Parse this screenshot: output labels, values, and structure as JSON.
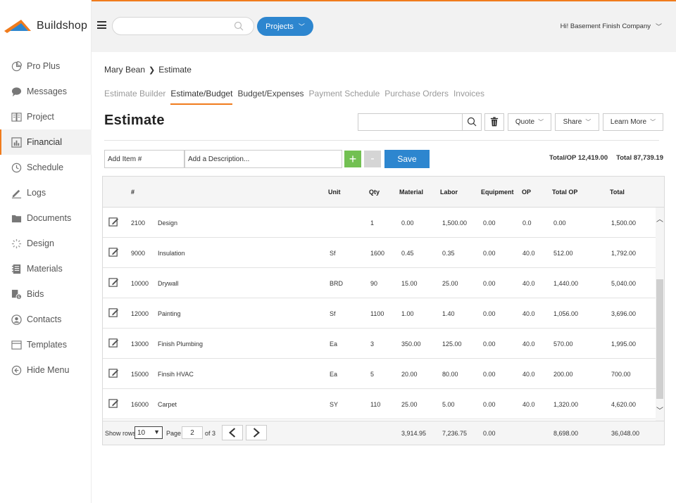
{
  "brand": {
    "name": "Buildshop"
  },
  "sidebar": {
    "items": [
      {
        "label": "Pro Plus",
        "icon": "pie-chart-icon"
      },
      {
        "label": "Messages",
        "icon": "chat-bubble-icon"
      },
      {
        "label": "Project",
        "icon": "book-icon"
      },
      {
        "label": "Financial",
        "icon": "bar-chart-icon",
        "active": true
      },
      {
        "label": "Schedule",
        "icon": "clock-icon"
      },
      {
        "label": "Logs",
        "icon": "pencil-icon"
      },
      {
        "label": "Documents",
        "icon": "folder-icon"
      },
      {
        "label": "Design",
        "icon": "spinner-icon"
      },
      {
        "label": "Materials",
        "icon": "binder-icon"
      },
      {
        "label": "Bids",
        "icon": "bids-icon"
      },
      {
        "label": "Contacts",
        "icon": "contact-icon"
      },
      {
        "label": "Templates",
        "icon": "template-icon"
      },
      {
        "label": "Hide Menu",
        "icon": "arrow-left-circle-icon"
      }
    ]
  },
  "header": {
    "search_placeholder": "",
    "projects_label": "Projects",
    "greeting": "Hi! Basement Finish Company"
  },
  "breadcrumb": {
    "client": "Mary Bean",
    "current": "Estimate"
  },
  "tabs": [
    {
      "label": "Estimate Builder",
      "state": "inactive"
    },
    {
      "label": "Estimate/Budget",
      "state": "active"
    },
    {
      "label": "Budget/Expenses",
      "state": "dark"
    },
    {
      "label": "Payment Schedule",
      "state": "inactive"
    },
    {
      "label": "Purchase Orders",
      "state": "inactive"
    },
    {
      "label": "Invoices",
      "state": "inactive"
    }
  ],
  "page_title": "Estimate",
  "toolbar": {
    "quote_label": "Quote",
    "share_label": "Share",
    "learn_more_label": "Learn More"
  },
  "entry": {
    "item_placeholder": "Add Item #",
    "description_placeholder": "Add a Description...",
    "add_label": "+",
    "remove_label": "-",
    "save_label": "Save"
  },
  "totals": {
    "total_op": "Total/OP 12,419.00",
    "total": "Total 87,739.19"
  },
  "table": {
    "columns": [
      "#",
      "Unit",
      "Qty",
      "Material",
      "Labor",
      "Equipment",
      "OP",
      "Total OP",
      "Total"
    ],
    "rows": [
      {
        "num": "2100",
        "desc": "Design",
        "unit": "",
        "qty": "1",
        "material": "0.00",
        "labor": "1,500.00",
        "equipment": "0.00",
        "op": "0.0",
        "total_op": "0.00",
        "total": "1,500.00"
      },
      {
        "num": "9000",
        "desc": "Insulation",
        "unit": "Sf",
        "qty": "1600",
        "material": "0.45",
        "labor": "0.35",
        "equipment": "0.00",
        "op": "40.0",
        "total_op": "512.00",
        "total": "1,792.00"
      },
      {
        "num": "10000",
        "desc": "Drywall",
        "unit": "BRD",
        "qty": "90",
        "material": "15.00",
        "labor": "25.00",
        "equipment": "0.00",
        "op": "40.0",
        "total_op": "1,440.00",
        "total": "5,040.00"
      },
      {
        "num": "12000",
        "desc": "Painting",
        "unit": "Sf",
        "qty": "1100",
        "material": "1.00",
        "labor": "1.40",
        "equipment": "0.00",
        "op": "40.0",
        "total_op": "1,056.00",
        "total": "3,696.00"
      },
      {
        "num": "13000",
        "desc": "Finish Plumbing",
        "unit": "Ea",
        "qty": "3",
        "material": "350.00",
        "labor": "125.00",
        "equipment": "0.00",
        "op": "40.0",
        "total_op": "570.00",
        "total": "1,995.00"
      },
      {
        "num": "15000",
        "desc": "Finsih HVAC",
        "unit": "Ea",
        "qty": "5",
        "material": "20.00",
        "labor": "80.00",
        "equipment": "0.00",
        "op": "40.0",
        "total_op": "200.00",
        "total": "700.00"
      },
      {
        "num": "16000",
        "desc": "Carpet",
        "unit": "SY",
        "qty": "110",
        "material": "25.00",
        "labor": "5.00",
        "equipment": "0.00",
        "op": "40.0",
        "total_op": "1,320.00",
        "total": "4,620.00"
      }
    ],
    "footer": {
      "show_rows_label": "Show rows",
      "rows_value": "10",
      "page_label": "Page",
      "page_value": "2",
      "page_of": "of 3",
      "material_sum": "3,914.95",
      "labor_sum": "7,236.75",
      "equipment_sum": "0.00",
      "total_op_sum": "8,698.00",
      "total_sum": "36,048.00"
    }
  },
  "colors": {
    "accent": "#f07b1c",
    "primary": "#2d86cf",
    "add": "#72c052"
  }
}
